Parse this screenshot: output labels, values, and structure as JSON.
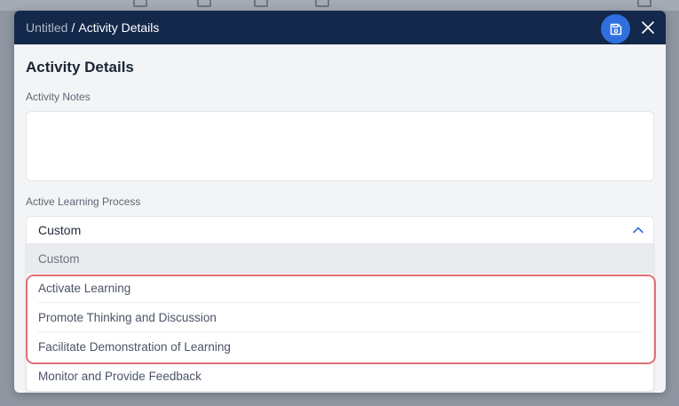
{
  "modal": {
    "breadcrumb_root": "Untitled",
    "breadcrumb_separator": "/",
    "breadcrumb_current": "Activity Details",
    "title": "Activity Details"
  },
  "notes": {
    "label": "Activity Notes",
    "value": ""
  },
  "process": {
    "label": "Active Learning Process",
    "selected": "Custom",
    "options": [
      "Custom",
      "Activate Learning",
      "Promote Thinking and Discussion",
      "Facilitate Demonstration of Learning",
      "Monitor and Provide Feedback"
    ]
  },
  "icons": {
    "save": "save-icon",
    "close": "close-icon",
    "dropdown": "chevron-up-icon"
  },
  "colors": {
    "header_bg": "#13284a",
    "save_button": "#2f6fe0",
    "highlight_border": "#e07078",
    "selected_option_bg": "#e9ebee"
  }
}
